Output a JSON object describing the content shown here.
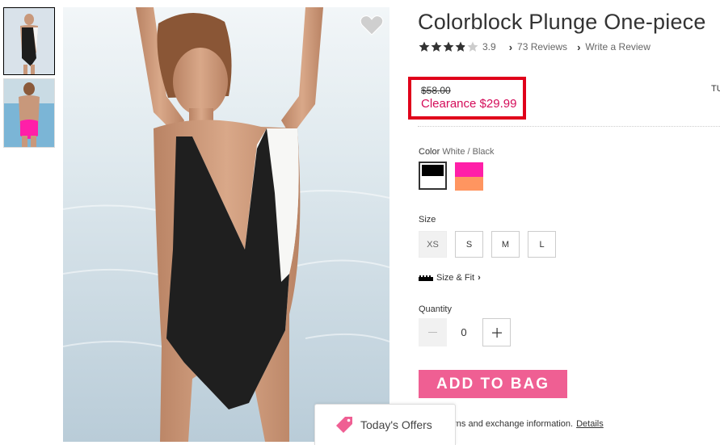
{
  "product": {
    "title": "Colorblock Plunge One-piece",
    "rating": {
      "stars": 3.9,
      "value": "3.9",
      "reviews_link": "73 Reviews",
      "write_link": "Write a Review"
    },
    "price": {
      "original": "$58.00",
      "sale": "Clearance $29.99"
    },
    "cutoff_text": "TU",
    "color": {
      "label": "Color",
      "value": "White / Black",
      "swatches": [
        {
          "top": "#000000",
          "bottom": "#ffffff"
        },
        {
          "top": "#ff1fa8",
          "bottom": "#ff9560"
        }
      ]
    },
    "size": {
      "label": "Size",
      "options": [
        "XS",
        "S",
        "M",
        "L"
      ],
      "unavailable": [
        "XS"
      ]
    },
    "size_fit_link": "Size & Fit",
    "quantity": {
      "label": "Quantity",
      "value": "0"
    },
    "add_to_bag": "ADD TO BAG",
    "returns_text": "urns and exchange information.",
    "details_link": "Details"
  },
  "offers_tab": {
    "label": "Today's Offers"
  },
  "icons": {
    "wishlist": "heart-icon",
    "size_fit": "ruler-icon",
    "offers": "tag-icon"
  },
  "colors": {
    "accent_pink": "#ef5f93",
    "sale_red": "#d40c59",
    "highlight_box": "#e0001a"
  }
}
